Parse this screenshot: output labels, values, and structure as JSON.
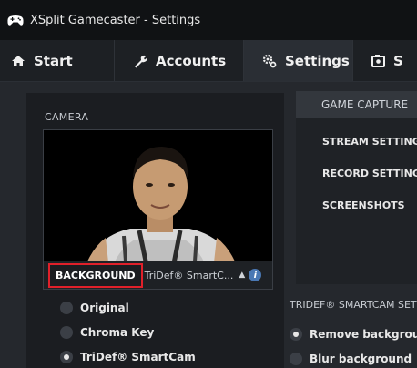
{
  "window": {
    "title": "XSplit Gamecaster - Settings",
    "app_icon": "gamepad-icon"
  },
  "tabs": [
    {
      "label": "Start",
      "icon": "home-icon"
    },
    {
      "label": "Accounts",
      "icon": "wrench-icon"
    },
    {
      "label": "Settings",
      "icon": "gears-icon"
    },
    {
      "label": "S",
      "icon": "screenshot-icon"
    }
  ],
  "camera": {
    "section_label": "CAMERA",
    "background_label": "BACKGROUND",
    "background_value": "TriDef® SmartC...",
    "options": [
      {
        "label": "Original",
        "selected": false
      },
      {
        "label": "Chroma Key",
        "selected": false
      },
      {
        "label": "TriDef® SmartCam",
        "selected": true
      }
    ]
  },
  "side_menu": {
    "header": "GAME CAPTURE",
    "items": [
      "STREAM SETTING",
      "RECORD SETTING",
      "SCREENSHOTS"
    ]
  },
  "tridef": {
    "section_label": "TRIDEF® SMARTCAM SET",
    "options": [
      {
        "label": "Remove background",
        "selected": true
      },
      {
        "label": "Blur background",
        "selected": false
      }
    ]
  },
  "colors": {
    "highlight_box": "#e0202a",
    "info": "#4a78b4",
    "bg": "#25282d"
  }
}
